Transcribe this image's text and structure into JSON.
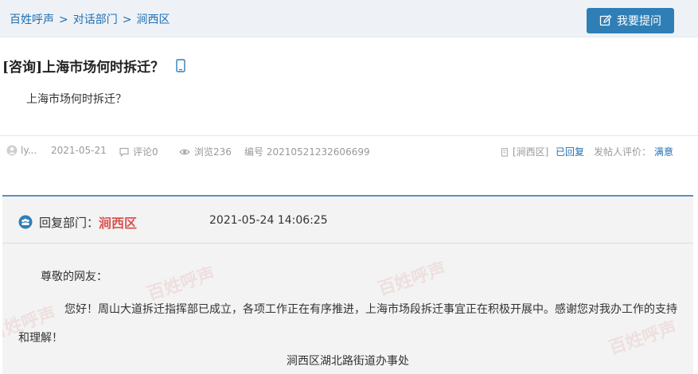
{
  "breadcrumb": {
    "items": [
      "百姓呼声",
      "对话部门",
      "涧西区"
    ],
    "sep": ">"
  },
  "ask_button": {
    "label": "我要提问"
  },
  "question": {
    "tag": "[咨询]",
    "title": "上海市场何时拆迁？",
    "content": "上海市场何时拆迁？"
  },
  "meta": {
    "user": "ly...",
    "date": "2021-05-21",
    "comments": "评论0",
    "views": "浏览236",
    "number": "编号 20210521232606699",
    "district": "[涧西区]",
    "status": "已回复",
    "rating_label": "发帖人评价：",
    "rating_value": "满意"
  },
  "reply": {
    "dept_label": "回复部门：",
    "dept_name": "涧西区",
    "time": "2021-05-24 14:06:25",
    "greeting": "尊敬的网友：",
    "body": "您好！周山大道拆迁指挥部已成立，各项工作正在有序推进，上海市场段拆迁事宜正在积极开展中。感谢您对我办工作的支持和理解！",
    "signature": "涧西区湖北路街道办事处",
    "watermark": "百姓呼声"
  },
  "colors": {
    "accent": "#2f7fb6",
    "link": "#1f6fb2",
    "dept": "#d9534f"
  }
}
